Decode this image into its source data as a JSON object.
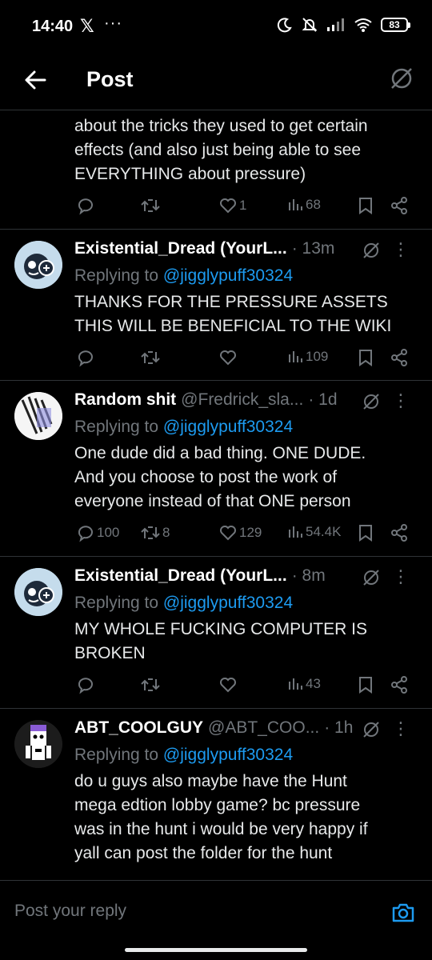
{
  "status_bar": {
    "time": "14:40",
    "x_logo": "𝕏",
    "dots": "···",
    "battery": "83"
  },
  "header": {
    "title": "Post"
  },
  "top_fragment": {
    "lines": [
      "about the tricks they used to get certain",
      "effects (and also just being able to see",
      "EVERYTHING about pressure)"
    ],
    "stats": {
      "likes": "1",
      "views": "68"
    }
  },
  "replies": [
    {
      "name": "Existential_Dread (YourL...",
      "handle": "",
      "time": "· 13m",
      "replying_prefix": "Replying to ",
      "mention": "@jigglypuff30324",
      "lines": [
        "THANKS FOR THE PRESSURE ASSETS",
        "THIS WILL BE BENEFICIAL TO THE WIKI"
      ],
      "stats": {
        "replies": "",
        "reposts": "",
        "likes": "",
        "views": "109"
      }
    },
    {
      "name": "Random shit",
      "handle": "@Fredrick_sla...",
      "time": "· 1d",
      "replying_prefix": "Replying to ",
      "mention": "@jigglypuff30324",
      "lines": [
        "One dude did a bad thing. ONE DUDE.",
        "And you choose to post the work of",
        "everyone instead of that ONE person"
      ],
      "stats": {
        "replies": "100",
        "reposts": "8",
        "likes": "129",
        "views": "54.4K"
      }
    },
    {
      "name": "Existential_Dread (YourL...",
      "handle": "",
      "time": "· 8m",
      "replying_prefix": "Replying to ",
      "mention": "@jigglypuff30324",
      "lines": [
        "MY WHOLE FUCKING COMPUTER IS",
        "BROKEN"
      ],
      "stats": {
        "replies": "",
        "reposts": "",
        "likes": "",
        "views": "43"
      }
    },
    {
      "name": "ABT_COOLGUY",
      "handle": "@ABT_COO...",
      "time": "· 1h",
      "replying_prefix": "Replying to ",
      "mention": "@jigglypuff30324",
      "lines": [
        "do u guys also maybe have the Hunt",
        "mega edtion lobby game? bc pressure",
        "was in the hunt i would be very happy if",
        "yall can post the folder for the hunt"
      ]
    }
  ],
  "composer": {
    "placeholder": "Post your reply"
  },
  "colors": {
    "background": "#000000",
    "accent": "#1d9bf0",
    "muted": "#71767b",
    "text": "#e7e9ea",
    "divider": "#2f3336"
  }
}
